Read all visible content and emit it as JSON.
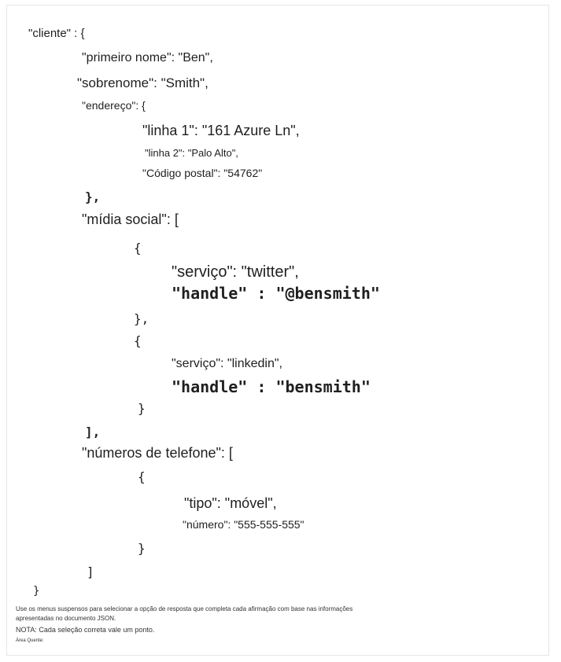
{
  "json_doc": {
    "cliente_open": "\"cliente\" : {",
    "primeiro_nome": "\"primeiro nome\": \"Ben\",",
    "sobrenome": "\"sobrenome\": \"Smith\",",
    "endereco_open": "\"endereço\": {",
    "linha1": "\"linha 1\": \"161 Azure Ln\",",
    "linha2": "\"linha 2\": \"Palo Alto\",",
    "codigo_postal": "\"Código postal\": \"54762\"",
    "endereco_close": "},",
    "midia_open": "\"mídia social\": [",
    "obj1_open": "{",
    "servico_twitter": "\"serviço\": \"twitter\",",
    "handle_twitter": "\"handle\" : \"@bensmith\"",
    "obj1_close": "},",
    "obj2_open": "{",
    "servico_linkedin": "\"serviço\": \"linkedin\",",
    "handle_linkedin": "\"handle\" : \"bensmith\"",
    "obj2_close": "}",
    "midia_close": "],",
    "telefones_open": "\"números de telefone\": [",
    "obj3_open": "{",
    "tipo": "\"tipo\": \"móvel\",",
    "numero": "\"número\": \"555-555-555\"",
    "obj3_close": "}",
    "telefones_close": "]",
    "cliente_close": "}"
  },
  "footer": {
    "instruction_line1": "Use os menus suspensos para selecionar a opção de resposta que completa cada afirmação com base nas informações",
    "instruction_line2": "apresentadas no documento JSON.",
    "note": "NOTA: Cada seleção correta vale um ponto.",
    "hot_area": "Área Quente:"
  }
}
